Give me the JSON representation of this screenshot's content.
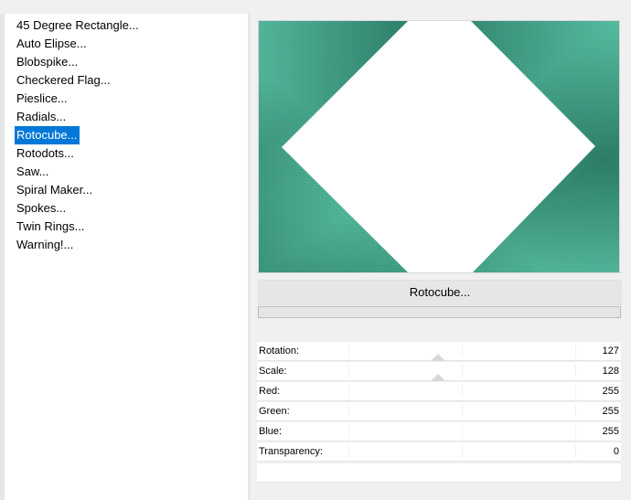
{
  "filter_list": {
    "items": [
      "45 Degree Rectangle...",
      "Auto Elipse...",
      "Blobspike...",
      "Checkered Flag...",
      "Pieslice...",
      "Radials...",
      "Rotocube...",
      "Rotodots...",
      "Saw...",
      "Spiral Maker...",
      "Spokes...",
      "Twin Rings...",
      "Warning!..."
    ],
    "selected_index": 6
  },
  "preview": {
    "background_color": "#3c9f86",
    "shape_color": "#ffffff"
  },
  "filter_title": "Rotocube...",
  "progress": 0,
  "params": [
    {
      "label": "Rotation:",
      "value": "127"
    },
    {
      "label": "Scale:",
      "value": "128"
    },
    {
      "label": "Red:",
      "value": "255"
    },
    {
      "label": "Green:",
      "value": "255"
    },
    {
      "label": "Blue:",
      "value": "255"
    },
    {
      "label": "Transparency:",
      "value": "0"
    }
  ]
}
